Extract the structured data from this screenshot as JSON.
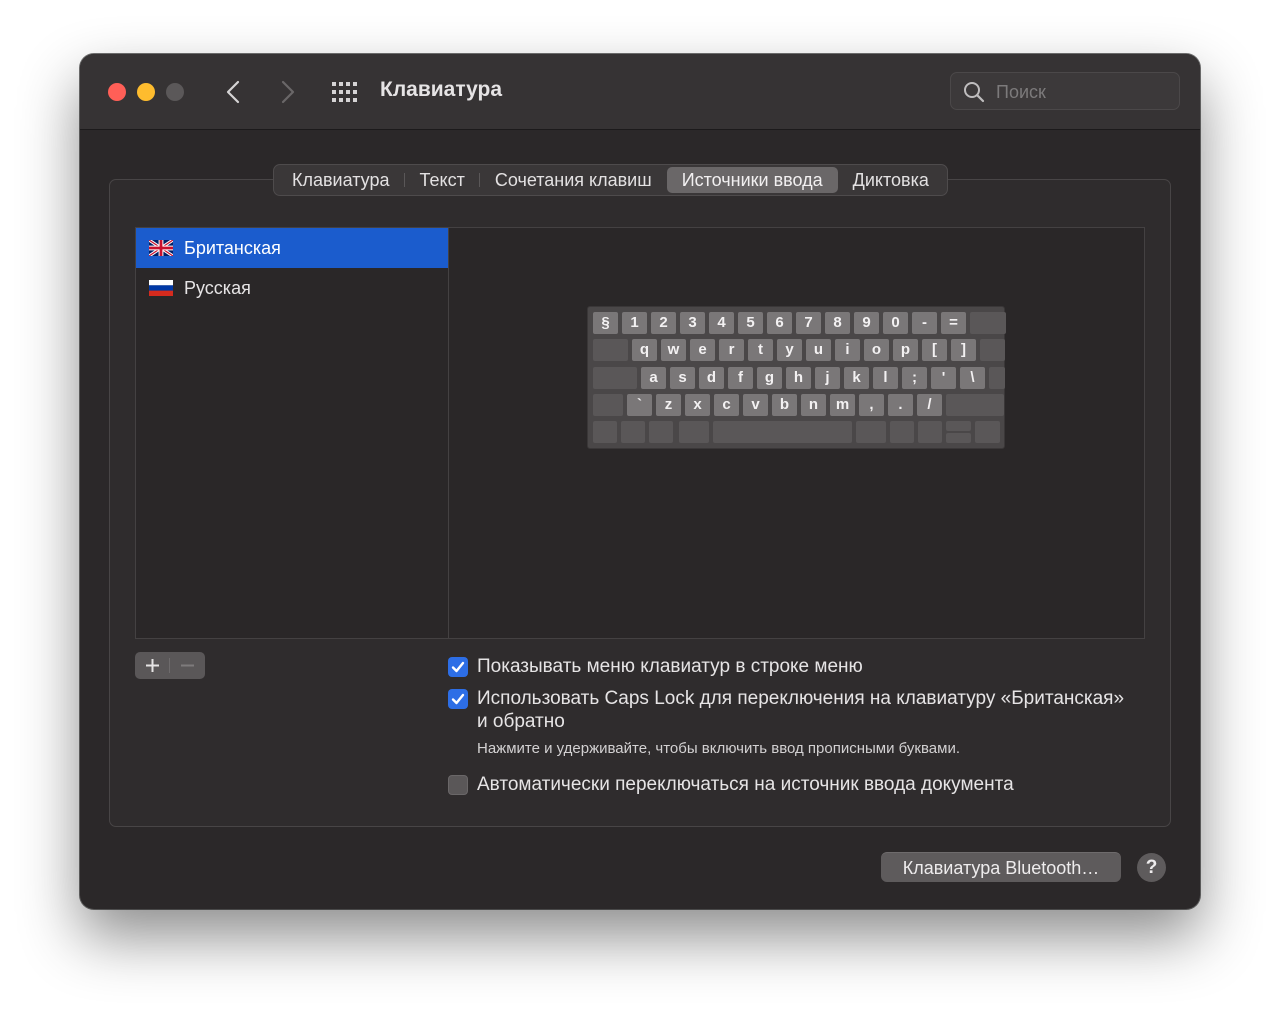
{
  "window": {
    "title": "Клавиатура",
    "search_placeholder": "Поиск"
  },
  "tabs": [
    {
      "label": "Клавиатура",
      "active": false
    },
    {
      "label": "Текст",
      "active": false
    },
    {
      "label": "Сочетания клавиш",
      "active": false
    },
    {
      "label": "Источники ввода",
      "active": true
    },
    {
      "label": "Диктовка",
      "active": false
    }
  ],
  "input_sources": [
    {
      "label": "Британская",
      "flag": "uk-flag",
      "selected": true
    },
    {
      "label": "Русская",
      "flag": "russia-flag",
      "selected": false
    }
  ],
  "keyboard_rows": [
    [
      "§",
      "1",
      "2",
      "3",
      "4",
      "5",
      "6",
      "7",
      "8",
      "9",
      "0",
      "-",
      "="
    ],
    [
      "q",
      "w",
      "e",
      "r",
      "t",
      "y",
      "u",
      "i",
      "o",
      "p",
      "[",
      "]"
    ],
    [
      "a",
      "s",
      "d",
      "f",
      "g",
      "h",
      "j",
      "k",
      "l",
      ";",
      "'",
      "\\"
    ],
    [
      "`",
      "z",
      "x",
      "c",
      "v",
      "b",
      "n",
      "m",
      ",",
      ".",
      "/"
    ]
  ],
  "buttons": {
    "add": "+",
    "remove": "−",
    "bluetooth": "Клавиатура Bluetooth…",
    "help": "?"
  },
  "options": {
    "show_menu": {
      "label": "Показывать меню клавиатур в строке меню",
      "checked": true
    },
    "caps_lock": {
      "label_line1": "Использовать Caps Lock для переключения на клавиатуру «Британская»",
      "label_line2": "и обратно",
      "checked": true
    },
    "caps_lock_hint": "Нажмите и удерживайте, чтобы включить ввод прописными буквами.",
    "auto_switch": {
      "label": "Автоматически переключаться на источник ввода документа",
      "checked": false
    }
  },
  "colors": {
    "accent": "#2d6ee6",
    "selection": "#1b5ccd",
    "close": "#ff5f57",
    "minimize": "#febc2e"
  }
}
